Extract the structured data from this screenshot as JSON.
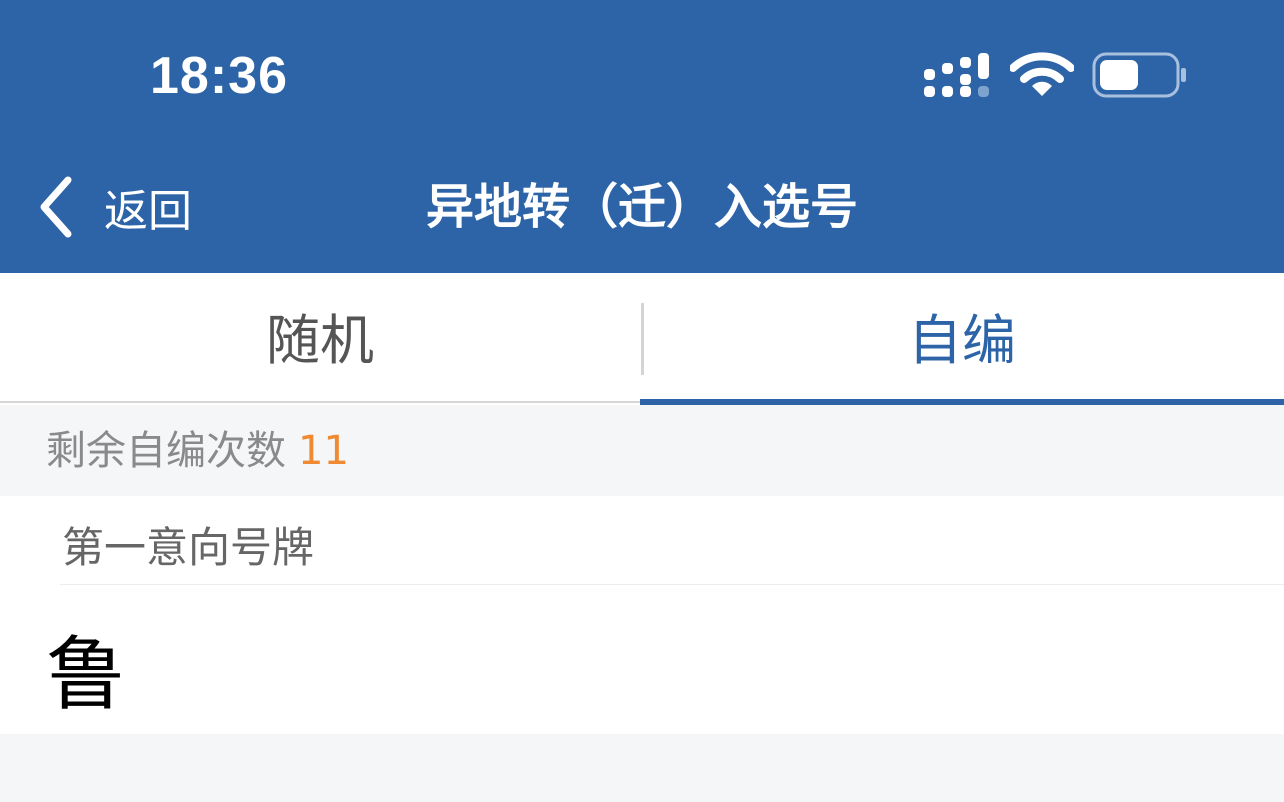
{
  "status_bar": {
    "time": "18:36"
  },
  "nav": {
    "back_label": "返回",
    "title": "异地转（迁）入选号"
  },
  "tabs": [
    {
      "label": "随机",
      "active": false
    },
    {
      "label": "自编",
      "active": true
    }
  ],
  "remaining": {
    "label": "剩余自编次数",
    "count": "11"
  },
  "plate": {
    "label": "第一意向号牌",
    "province": "鲁"
  },
  "colors": {
    "header_bg": "#2d64a8",
    "accent": "#2d64a8",
    "count_color": "#f08a32",
    "page_bg": "#f4f6f8"
  },
  "icons": [
    "signal-icon",
    "wifi-icon",
    "battery-icon",
    "back-chevron-icon"
  ]
}
